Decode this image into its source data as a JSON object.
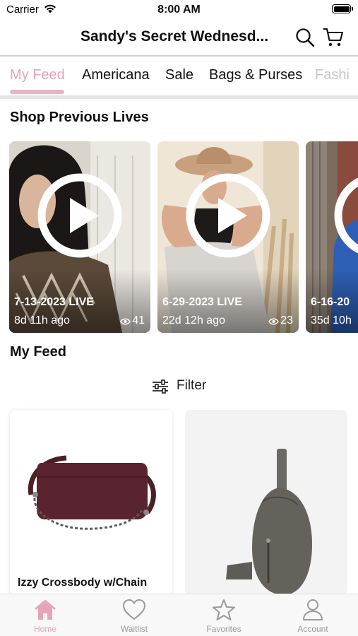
{
  "status_bar": {
    "carrier": "Carrier",
    "time": "8:00 AM"
  },
  "header": {
    "title": "Sandy's Secret Wednesd...",
    "search_icon": "search-icon",
    "cart_icon": "cart-icon"
  },
  "tabs": [
    {
      "label": "My Feed",
      "active": true
    },
    {
      "label": "Americana",
      "active": false
    },
    {
      "label": "Sale",
      "active": false
    },
    {
      "label": "Bags & Purses",
      "active": false
    },
    {
      "label": "Fashi",
      "active": false
    }
  ],
  "previous_lives": {
    "title": "Shop Previous Lives",
    "items": [
      {
        "date": "7-13-2023 LIVE",
        "ago": "8d 11h ago",
        "views": "41"
      },
      {
        "date": "6-29-2023 LIVE",
        "ago": "22d 12h ago",
        "views": "23"
      },
      {
        "date": "6-16-20",
        "ago": "35d 10h",
        "views": ""
      }
    ]
  },
  "feed": {
    "title": "My Feed",
    "filter_label": "Filter",
    "products": [
      {
        "name": "Izzy Crossbody w/Chain"
      },
      {
        "name": ""
      }
    ]
  },
  "bottom_nav": [
    {
      "label": "Home",
      "icon": "home-icon",
      "active": true
    },
    {
      "label": "Waitlist",
      "icon": "heart-icon",
      "active": false
    },
    {
      "label": "Favorites",
      "icon": "star-icon",
      "active": false
    },
    {
      "label": "Account",
      "icon": "person-icon",
      "active": false
    }
  ],
  "colors": {
    "accent_pink": "#e7a4b8",
    "divider_pink": "#e6c5cf",
    "inactive_gray": "#9a9a9a"
  }
}
